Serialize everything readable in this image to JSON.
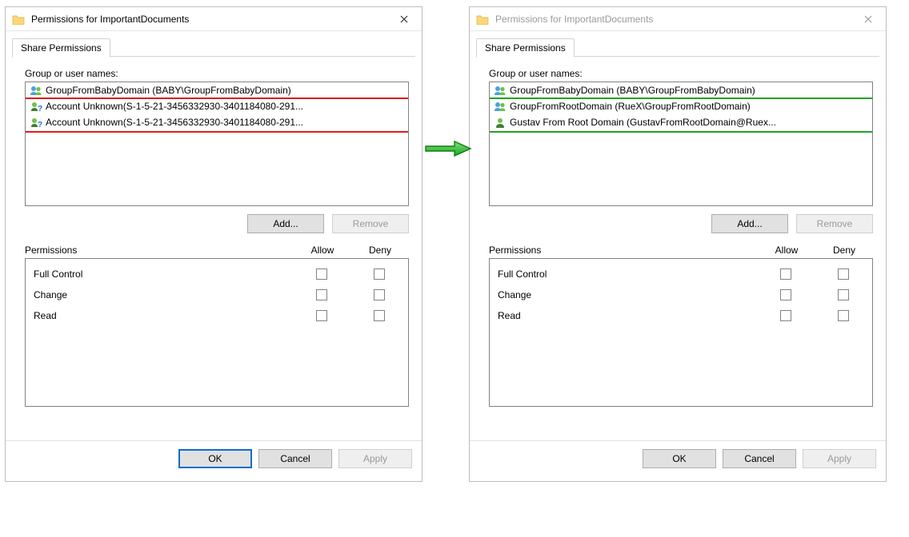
{
  "left": {
    "title": "Permissions for ImportantDocuments",
    "tab": "Share Permissions",
    "groupLabel": "Group or user names:",
    "rows": [
      {
        "icon": "group",
        "text": "GroupFromBabyDomain (BABY\\GroupFromBabyDomain)"
      },
      {
        "icon": "unknown",
        "text": "Account Unknown(S-1-5-21-3456332930-3401184080-291..."
      },
      {
        "icon": "unknown",
        "text": "Account Unknown(S-1-5-21-3456332930-3401184080-291..."
      }
    ],
    "addLabel": "Add...",
    "removeLabel": "Remove",
    "permHeader": "Permissions",
    "allow": "Allow",
    "deny": "Deny",
    "perms": [
      "Full Control",
      "Change",
      "Read"
    ],
    "ok": "OK",
    "cancel": "Cancel",
    "apply": "Apply",
    "highlightColor": "#e11a1a"
  },
  "right": {
    "title": "Permissions for ImportantDocuments",
    "tab": "Share Permissions",
    "groupLabel": "Group or user names:",
    "rows": [
      {
        "icon": "group",
        "text": "GroupFromBabyDomain (BABY\\GroupFromBabyDomain)"
      },
      {
        "icon": "group",
        "text": "GroupFromRootDomain (RueX\\GroupFromRootDomain)"
      },
      {
        "icon": "user",
        "text": "Gustav From Root Domain (GustavFromRootDomain@Ruex..."
      }
    ],
    "addLabel": "Add...",
    "removeLabel": "Remove",
    "permHeader": "Permissions",
    "allow": "Allow",
    "deny": "Deny",
    "perms": [
      "Full Control",
      "Change",
      "Read"
    ],
    "ok": "OK",
    "cancel": "Cancel",
    "apply": "Apply",
    "highlightColor": "#1fa51f"
  }
}
